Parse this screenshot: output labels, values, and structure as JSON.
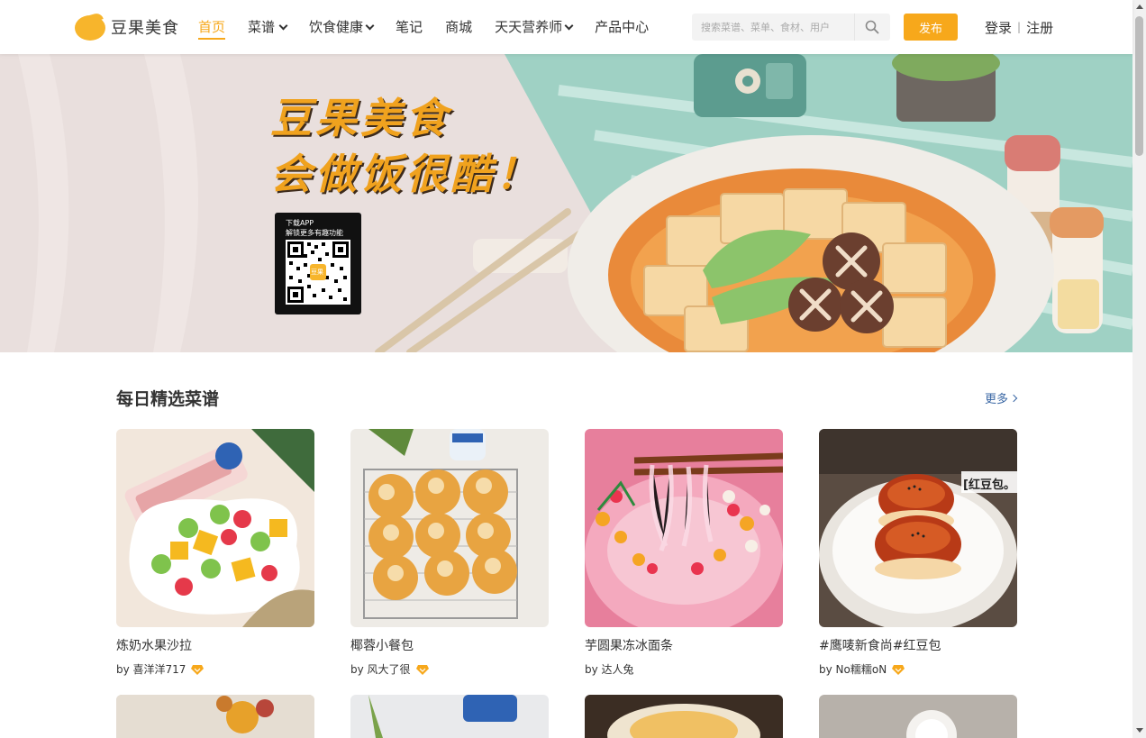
{
  "brand": {
    "name": "豆果美食"
  },
  "nav": {
    "items": [
      {
        "label": "首页",
        "active": true,
        "dropdown": false
      },
      {
        "label": "菜谱",
        "active": false,
        "dropdown": true
      },
      {
        "label": "饮食健康",
        "active": false,
        "dropdown": true
      },
      {
        "label": "笔记",
        "active": false,
        "dropdown": false
      },
      {
        "label": "商城",
        "active": false,
        "dropdown": false
      },
      {
        "label": "天天营养师",
        "active": false,
        "dropdown": true
      },
      {
        "label": "产品中心",
        "active": false,
        "dropdown": false
      }
    ]
  },
  "search": {
    "placeholder": "搜索菜谱、菜单、食材、用户",
    "icon": "search-icon"
  },
  "header": {
    "publish_label": "发布",
    "login_label": "登录",
    "separator": "|",
    "register_label": "注册"
  },
  "banner": {
    "title_line1": "豆果美食",
    "title_line2": "会做饭很酷！",
    "qr_line1": "下载APP",
    "qr_line2": "解锁更多有趣功能",
    "qr_center": "豆果"
  },
  "section": {
    "title": "每日精选菜谱",
    "more_label": "更多"
  },
  "recipes": [
    {
      "name": "炼奶水果沙拉",
      "author": "by 喜洋洋717",
      "badge": true
    },
    {
      "name": "椰蓉小餐包",
      "author": "by 风大了很",
      "badge": true
    },
    {
      "name": "芋圆果冻冰面条",
      "author": "by 达人兔",
      "badge": false
    },
    {
      "name": "#鹰唛新食尚#红豆包",
      "author": "by No糯糯oN",
      "badge": true
    }
  ],
  "photo_caption": "[红豆包。",
  "colors": {
    "accent": "#f7a81b",
    "link": "#3a67a4",
    "banner_bg": "#e9dfdd"
  }
}
